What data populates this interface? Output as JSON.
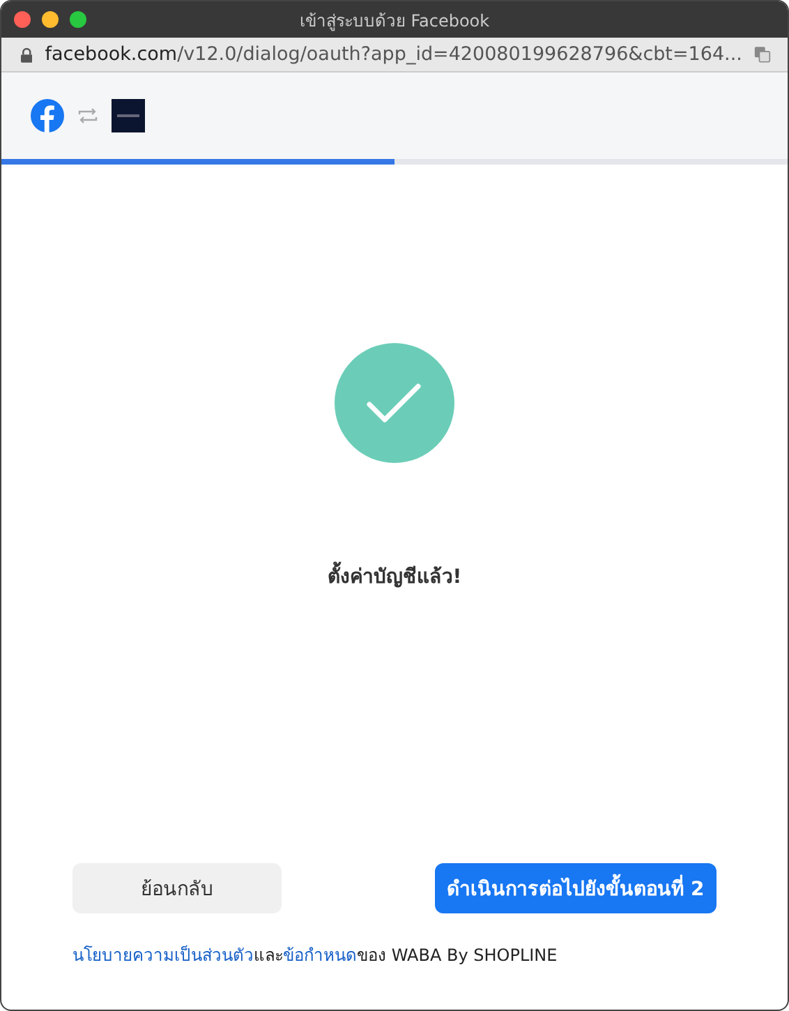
{
  "window": {
    "title": "เข้าสู่ระบบด้วย Facebook"
  },
  "address_bar": {
    "domain": "facebook.com",
    "path": "/v12.0/dialog/oauth?app_id=420080199628796&cbt=164..."
  },
  "progress": {
    "level": 0.5
  },
  "message": "ตั้งค่าบัญชีแล้ว!",
  "buttons": [
    {
      "label": "ย้อนกลับ",
      "kind": "secondary"
    },
    {
      "label": "ดำเนินการต่อไปยังขั้นตอนที่ 2",
      "kind": "primary"
    }
  ],
  "footer": {
    "privacy_link": "นโยบายความเป็นส่วนตัว",
    "joiner": "และ",
    "terms_link": "ข้อกำหนด",
    "suffix": "ของ WABA By SHOPLINE"
  }
}
